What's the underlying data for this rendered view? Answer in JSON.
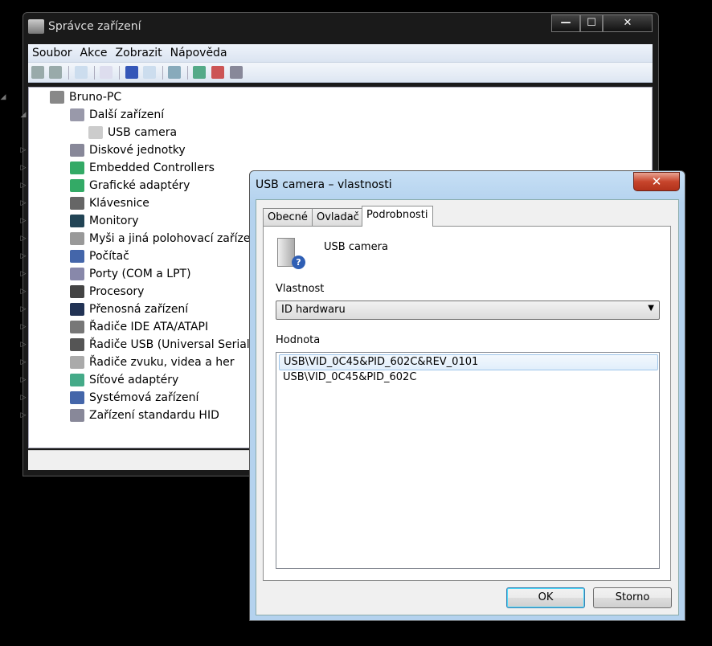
{
  "main_window": {
    "title": "Správce zařízení",
    "buttons": {
      "minimize": "—",
      "maximize": "☐",
      "close": "✕"
    }
  },
  "menu": [
    "Soubor",
    "Akce",
    "Zobrazit",
    "Nápověda"
  ],
  "tree": [
    {
      "label": "Bruno-PC",
      "level": 0,
      "expanded": true
    },
    {
      "label": "Další zařízení",
      "level": 1,
      "expanded": true
    },
    {
      "label": "USB camera",
      "level": 2
    },
    {
      "label": "Diskové jednotky",
      "level": 1
    },
    {
      "label": "Embedded Controllers",
      "level": 1
    },
    {
      "label": "Grafické adaptéry",
      "level": 1
    },
    {
      "label": "Klávesnice",
      "level": 1
    },
    {
      "label": "Monitory",
      "level": 1
    },
    {
      "label": "Myši a jiná polohovací zařízení",
      "level": 1
    },
    {
      "label": "Počítač",
      "level": 1
    },
    {
      "label": "Porty (COM a LPT)",
      "level": 1
    },
    {
      "label": "Procesory",
      "level": 1
    },
    {
      "label": "Přenosná zařízení",
      "level": 1
    },
    {
      "label": "Řadiče IDE ATA/ATAPI",
      "level": 1
    },
    {
      "label": "Řadiče USB (Universal Serial Bus)",
      "level": 1
    },
    {
      "label": "Řadiče zvuku, videa a her",
      "level": 1
    },
    {
      "label": "Síťové adaptéry",
      "level": 1
    },
    {
      "label": "Systémová zařízení",
      "level": 1
    },
    {
      "label": "Zařízení standardu HID",
      "level": 1
    }
  ],
  "dialog": {
    "title": "USB camera – vlastnosti",
    "close": "✕",
    "tabs": [
      "Obecné",
      "Ovladač",
      "Podrobnosti"
    ],
    "active_tab": "Podrobnosti",
    "device_name": "USB camera",
    "property_label": "Vlastnost",
    "property_value": "ID hardwaru",
    "value_label": "Hodnota",
    "values": [
      "USB\\VID_0C45&PID_602C&REV_0101",
      "USB\\VID_0C45&PID_602C"
    ],
    "ok": "OK",
    "cancel": "Storno"
  }
}
